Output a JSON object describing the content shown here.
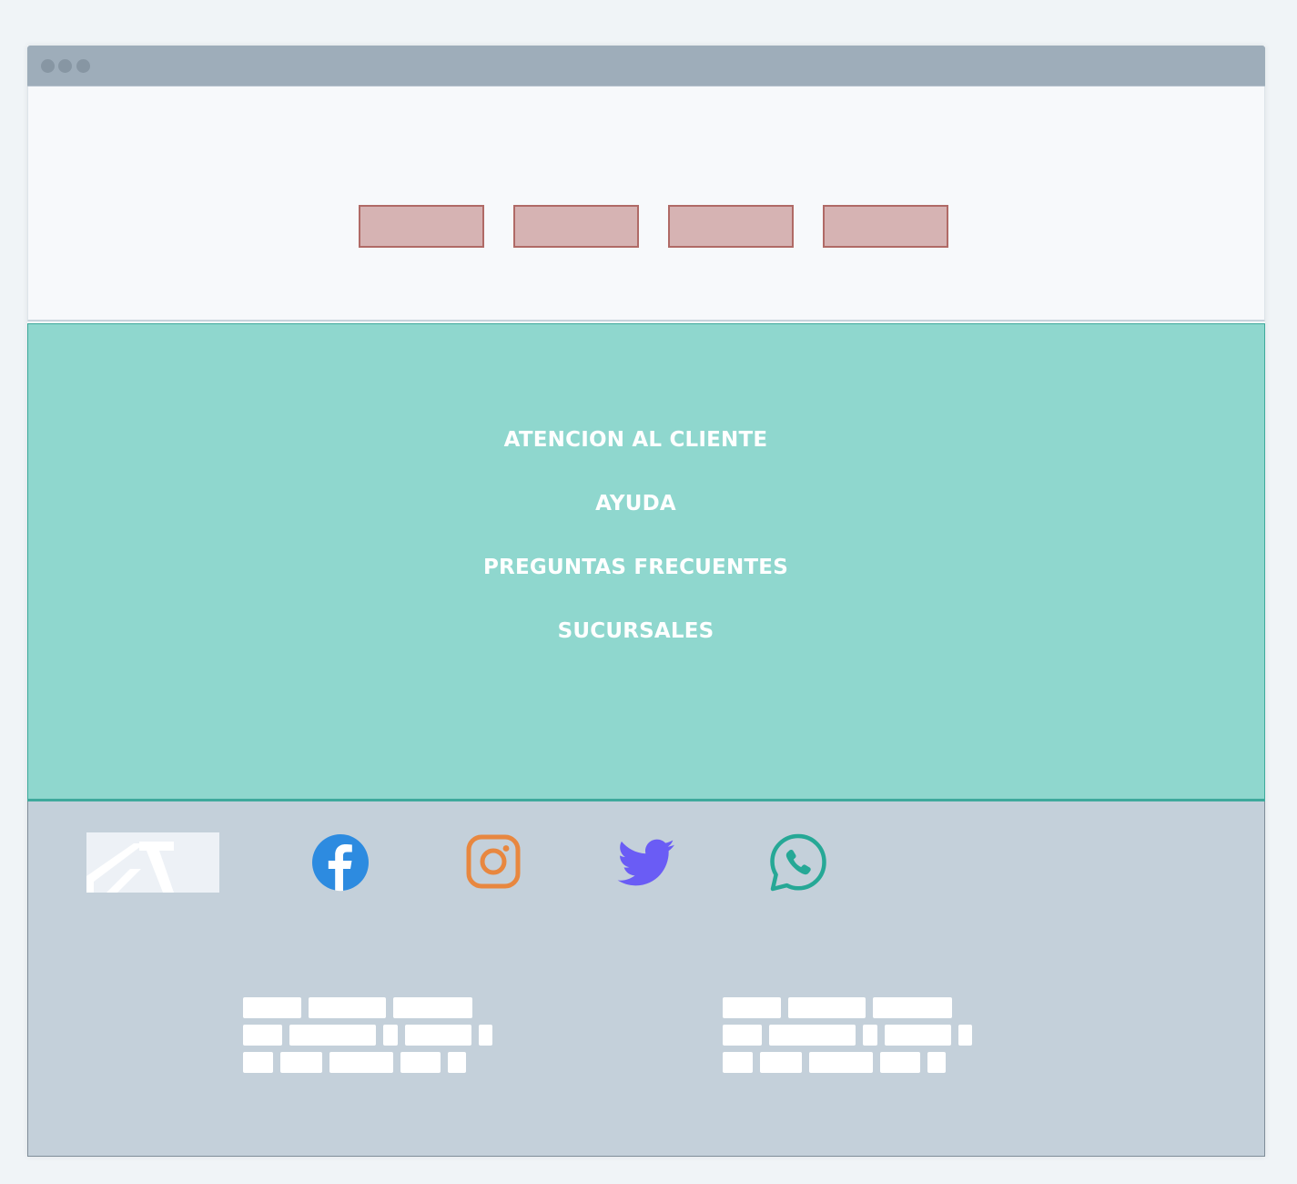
{
  "nav": {
    "items": [
      "",
      "",
      "",
      ""
    ]
  },
  "help_section": {
    "links": [
      "ATENCION AL CLIENTE",
      "AYUDA",
      "PREGUNTAS FRECUENTES",
      "SUCURSALES"
    ]
  },
  "footer": {
    "social_icons": [
      "facebook-icon",
      "instagram-icon",
      "twitter-icon",
      "whatsapp-icon"
    ]
  },
  "colors": {
    "teal_bg": "#8fd7ce",
    "teal_border": "#3ea99c",
    "nav_fill": "#d6b3b3",
    "nav_border": "#b06a66",
    "footer_bg": "#c4d0da",
    "facebook": "#2d8be0",
    "instagram": "#e8873f",
    "twitter": "#6a5cf5",
    "whatsapp": "#26a896"
  }
}
